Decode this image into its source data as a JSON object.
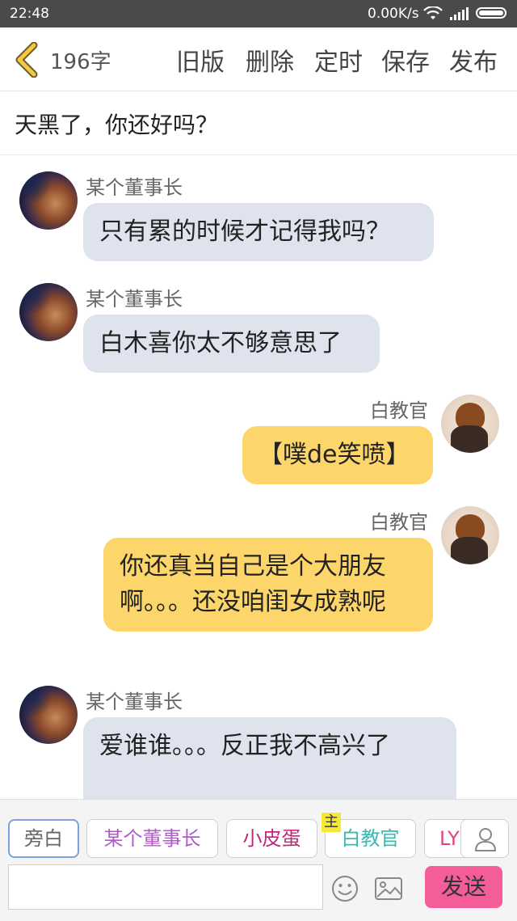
{
  "status_bar": {
    "time": "22:48",
    "net_speed": "0.00K/s"
  },
  "header": {
    "char_count": "196字",
    "buttons": [
      "旧版",
      "删除",
      "定时",
      "保存",
      "发布"
    ]
  },
  "title": "天黑了，你还好吗？",
  "messages": [
    {
      "speaker": "某个董事长",
      "text": "只有累的时候才记得我吗？"
    },
    {
      "speaker": "某个董事长",
      "text": "白木喜你太不够意思了"
    },
    {
      "speaker": "白教官",
      "text": "【噗de笑喷】"
    },
    {
      "speaker": "白教官",
      "text": "你还真当自己是个大朋友啊。。。还没咱闺女成熟呢"
    },
    {
      "speaker": "某个董事长",
      "text": "爱谁谁。。。反正我不高兴了"
    }
  ],
  "roles": [
    {
      "label": "旁白",
      "color": "#666666"
    },
    {
      "label": "某个董事长",
      "color": "#b05ac8"
    },
    {
      "label": "小皮蛋",
      "color": "#c0267a"
    },
    {
      "label": "白教官",
      "color": "#3bb8b0"
    },
    {
      "label": "LY",
      "color": "#e0457a"
    }
  ],
  "host_badge": "主",
  "input": {
    "placeholder": ""
  },
  "send_label": "发送"
}
